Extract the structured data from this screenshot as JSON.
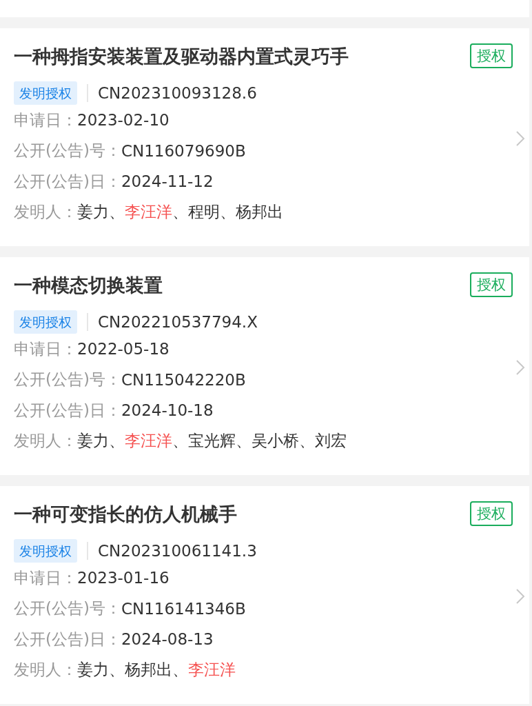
{
  "patents": [
    {
      "title": "一种拇指安装装置及驱动器内置式灵巧手",
      "status": "授权",
      "type_tag": "发明授权",
      "application_no": "CN202310093128.6",
      "fields": [
        {
          "label": "申请日：",
          "value": "2023-02-10"
        },
        {
          "label": "公开(公告)号：",
          "value": "CN116079690B"
        },
        {
          "label": "公开(公告)日：",
          "value": "2024-11-12"
        }
      ],
      "inventor_label": "发明人：",
      "inventors": [
        {
          "name": "姜力",
          "highlighted": false,
          "separator": "、"
        },
        {
          "name": "李汪洋",
          "highlighted": true,
          "separator": "、"
        },
        {
          "name": "程明",
          "highlighted": false,
          "separator": "、"
        },
        {
          "name": "杨邦出",
          "highlighted": false
        }
      ]
    },
    {
      "title": "一种模态切换装置",
      "status": "授权",
      "type_tag": "发明授权",
      "application_no": "CN202210537794.X",
      "fields": [
        {
          "label": "申请日：",
          "value": "2022-05-18"
        },
        {
          "label": "公开(公告)号：",
          "value": "CN115042220B"
        },
        {
          "label": "公开(公告)日：",
          "value": "2024-10-18"
        }
      ],
      "inventor_label": "发明人：",
      "inventors": [
        {
          "name": "姜力",
          "highlighted": false,
          "separator": "、"
        },
        {
          "name": "李汪洋",
          "highlighted": true,
          "separator": "、"
        },
        {
          "name": "宝光辉",
          "highlighted": false,
          "separator": "、"
        },
        {
          "name": "吴小桥",
          "highlighted": false,
          "separator": "、"
        },
        {
          "name": "刘宏",
          "highlighted": false
        }
      ]
    },
    {
      "title": "一种可变指长的仿人机械手",
      "status": "授权",
      "type_tag": "发明授权",
      "application_no": "CN202310061141.3",
      "fields": [
        {
          "label": "申请日：",
          "value": "2023-01-16"
        },
        {
          "label": "公开(公告)号：",
          "value": "CN116141346B"
        },
        {
          "label": "公开(公告)日：",
          "value": "2024-08-13"
        }
      ],
      "inventor_label": "发明人：",
      "inventors": [
        {
          "name": "姜力",
          "highlighted": false,
          "separator": "、"
        },
        {
          "name": "杨邦出",
          "highlighted": false,
          "separator": "、"
        },
        {
          "name": "李汪洋",
          "highlighted": true
        }
      ]
    }
  ]
}
